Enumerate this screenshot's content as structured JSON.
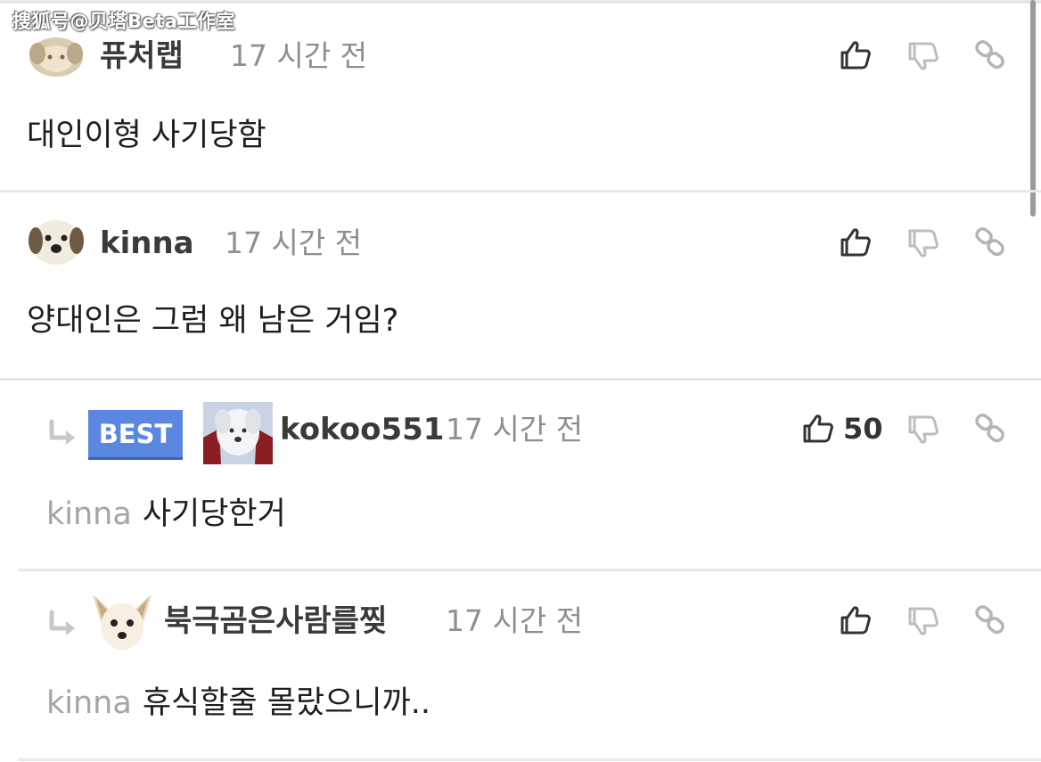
{
  "watermark": "搜狐号@贝塔Beta工作室",
  "comments": [
    {
      "username": "퓨처랩",
      "time": "17 시간 전",
      "text": "대인이형 사기당함",
      "avatar": "blurred-puppy-avatar"
    },
    {
      "username": "kinna",
      "time": "17 시간 전",
      "text": "양대인은 그럼 왜 남은 거임?",
      "avatar": "puppy-face-avatar"
    },
    {
      "badge": "BEST",
      "username": "kokoo551",
      "time": "17 시간 전",
      "like_count": "50",
      "mention": "kinna",
      "text": "사기당한거",
      "avatar": "white-dog-avatar"
    },
    {
      "username": "북극곰은사람를찢",
      "time": "17 시간 전",
      "mention": "kinna",
      "text": "휴식할줄 몰랐으니까..",
      "avatar": "chihuahua-avatar"
    }
  ],
  "colors": {
    "best_badge": "#5b87e0",
    "username": "#3a3a3a",
    "timestamp": "#8f8f8f",
    "mention": "#a5a5a5",
    "separator": "#e9e9e9"
  }
}
